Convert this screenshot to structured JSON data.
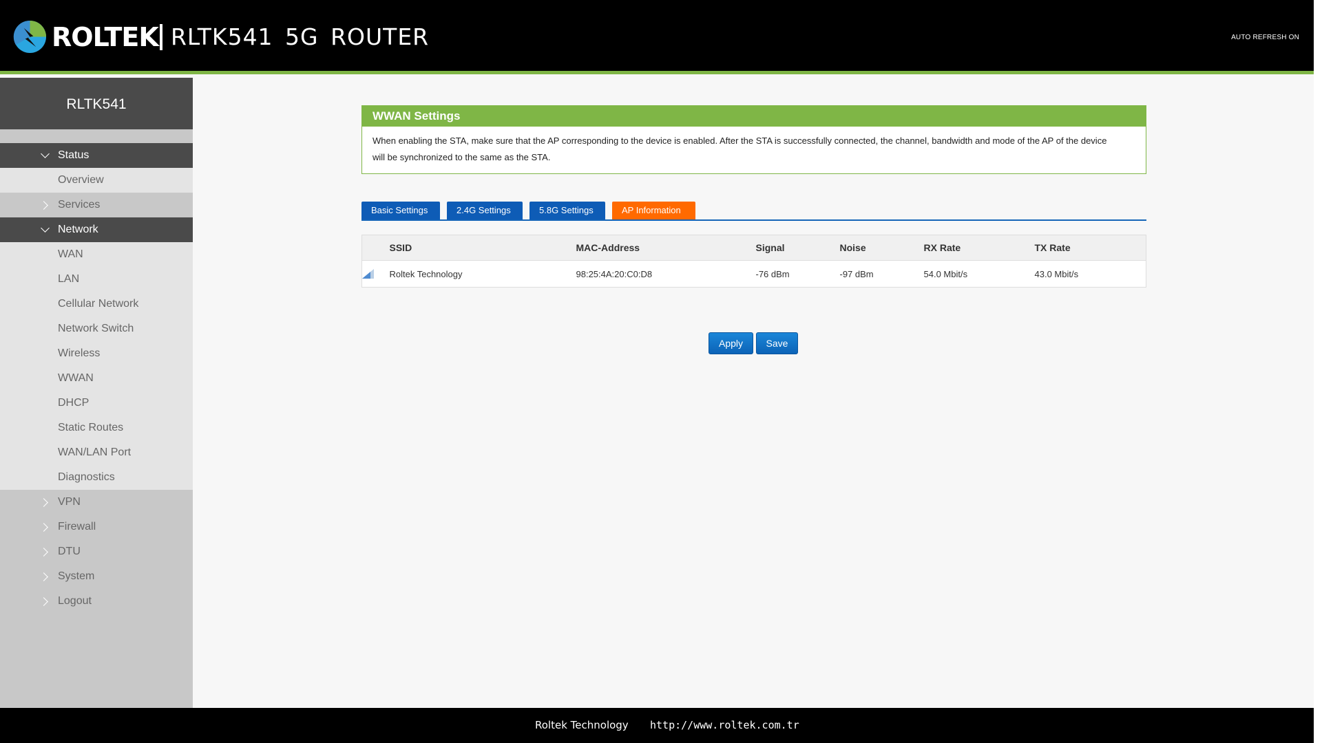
{
  "header": {
    "brand": "ROLTEK",
    "product_title": "RLTK541 5G ROUTER",
    "auto_refresh": "AUTO REFRESH ON",
    "accent_color": "#7fb646"
  },
  "sidebar": {
    "title": "RLTK541",
    "items": [
      {
        "label": "Status",
        "state": "open"
      },
      {
        "label": "Overview",
        "state": "child"
      },
      {
        "label": "Services",
        "state": "collapsed"
      },
      {
        "label": "Network",
        "state": "open"
      },
      {
        "label": "WAN",
        "state": "child"
      },
      {
        "label": "LAN",
        "state": "child"
      },
      {
        "label": "Cellular Network",
        "state": "child"
      },
      {
        "label": "Network Switch",
        "state": "child"
      },
      {
        "label": "Wireless",
        "state": "child"
      },
      {
        "label": "WWAN",
        "state": "child"
      },
      {
        "label": "DHCP",
        "state": "child"
      },
      {
        "label": "Static Routes",
        "state": "child"
      },
      {
        "label": "WAN/LAN Port",
        "state": "child"
      },
      {
        "label": "Diagnostics",
        "state": "child"
      },
      {
        "label": "VPN",
        "state": "collapsed"
      },
      {
        "label": "Firewall",
        "state": "collapsed"
      },
      {
        "label": "DTU",
        "state": "collapsed"
      },
      {
        "label": "System",
        "state": "collapsed"
      },
      {
        "label": "Logout",
        "state": "collapsed"
      }
    ]
  },
  "panel": {
    "title": "WWAN Settings",
    "description_line1": "When enabling the STA, make sure that the AP corresponding to the device is enabled. After the STA is successfully connected, the channel, bandwidth and mode of the AP of the device",
    "description_line2": "will be synchronized to the same as the STA."
  },
  "tabs": [
    {
      "label": "Basic Settings",
      "active": false
    },
    {
      "label": "2.4G Settings",
      "active": false
    },
    {
      "label": "5.8G Settings",
      "active": false
    },
    {
      "label": "AP Information",
      "active": true
    }
  ],
  "ap_table": {
    "headers": [
      "SSID",
      "MAC-Address",
      "Signal",
      "Noise",
      "RX Rate",
      "TX Rate"
    ],
    "rows": [
      {
        "signal_icon": "signal-strength-icon",
        "ssid": "Roltek Technology",
        "mac": "98:25:4A:20:C0:D8",
        "signal": "-76 dBm",
        "noise": "-97 dBm",
        "rx_rate": "54.0 Mbit/s",
        "tx_rate": "43.0 Mbit/s"
      }
    ]
  },
  "buttons": {
    "apply": "Apply",
    "save": "Save"
  },
  "footer": {
    "company": "Roltek Technology",
    "url": "http://www.roltek.com.tr"
  },
  "colors": {
    "tab_blue": "#0e5cb6",
    "tab_active": "#ff6a00",
    "button_blue": "#0c63b7"
  }
}
